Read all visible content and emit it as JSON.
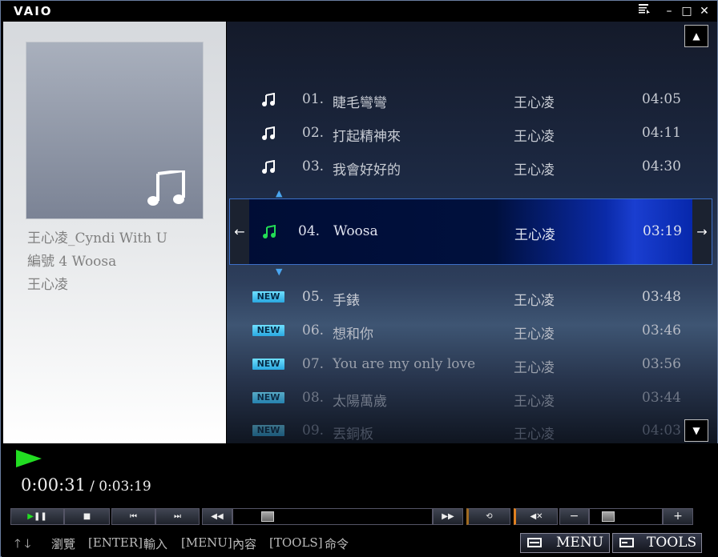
{
  "app": {
    "logo": "VAIO"
  },
  "titlebar": {
    "menu_icon": "⊞",
    "minimize": "–",
    "maximize": "□",
    "close": "✕"
  },
  "album": {
    "line1": "王心凌_Cyndi With U",
    "line2": "編號 4 Woosa",
    "line3": "王心凌"
  },
  "playlist": [
    {
      "num": "01.",
      "title": "睫毛彎彎",
      "artist": "王心凌",
      "dur": "04:05",
      "badge": ""
    },
    {
      "num": "02.",
      "title": "打起精神來",
      "artist": "王心凌",
      "dur": "04:11",
      "badge": ""
    },
    {
      "num": "03.",
      "title": "我會好好的",
      "artist": "王心凌",
      "dur": "04:30",
      "badge": ""
    },
    {
      "num": "04.",
      "title": "Woosa",
      "artist": "王心凌",
      "dur": "03:19",
      "badge": ""
    },
    {
      "num": "05.",
      "title": "手錶",
      "artist": "王心凌",
      "dur": "03:48",
      "badge": "NEW"
    },
    {
      "num": "06.",
      "title": "想和你",
      "artist": "王心凌",
      "dur": "03:46",
      "badge": "NEW"
    },
    {
      "num": "07.",
      "title": "You are my only love",
      "artist": "王心凌",
      "dur": "03:56",
      "badge": "NEW"
    },
    {
      "num": "08.",
      "title": "太陽萬歲",
      "artist": "王心凌",
      "dur": "03:44",
      "badge": "NEW"
    },
    {
      "num": "09.",
      "title": "丟銅板",
      "artist": "王心凌",
      "dur": "04:03",
      "badge": "NEW"
    }
  ],
  "player": {
    "elapsed": "0:00:31",
    "total": "/ 0:03:19"
  },
  "help": {
    "browse": "瀏覽",
    "enter_key": "[ENTER]",
    "enter_label": "輸入",
    "menu_key": "[MENU]",
    "menu_label": "內容",
    "tools_key": "[TOOLS]",
    "tools_label": "命令"
  },
  "buttons": {
    "menu": "MENU",
    "tools": "TOOLS"
  },
  "colors": {
    "accent_green": "#22dd22",
    "new_badge": "#4fc8f0",
    "selection": "#0a2aa8"
  }
}
